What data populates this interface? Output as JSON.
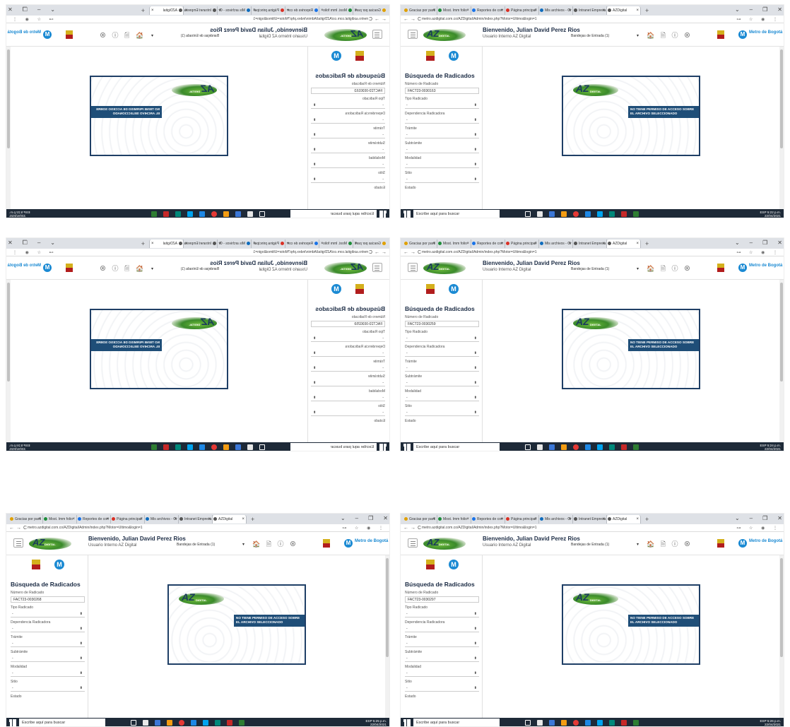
{
  "browser": {
    "tabs": [
      "Gracias por parti",
      "Most. Imm folio",
      "Reportes de corr",
      "Página principal",
      "Mis archivos - Or",
      "Intranet Empresa",
      "AZDigital"
    ],
    "new_tab": "+",
    "window_controls": [
      "⌄",
      "–",
      "❐",
      "✕"
    ]
  },
  "app": {
    "logo_main": "AZ",
    "logo_sub": "DIGITAL",
    "welcome": "Bienvenido, Julian David Perez Rios",
    "user_type": "Usuario Interno AZ Digital",
    "bandeja": "Bandejas de Entrada (1)",
    "header_icons": "🏠 🗎 ⓘ ⊗",
    "metro_logo_letter": "M",
    "metro_logo_text": "Metro de Bogotá",
    "panel_title": "Búsqueda de Radicados",
    "fields": {
      "numero_label": "Número de Radicado",
      "tipo_label": "Tipo Radicado",
      "dependencia_label": "Dependencia Radicadora",
      "tramite_label": "Trámite",
      "subtramite_label": "Subtrámite",
      "modalidad_label": "Modalidad",
      "sitio_label": "Sitio",
      "estado_label": "Estado",
      "select_default": "-"
    },
    "no_permission_message": "NO TIENE PERMISO DE ACCESO SOBRE EL ARCHIVO SELECCIONADO"
  },
  "taskbar": {
    "search_placeholder": "Escribe aquí para buscar",
    "lang": "ESP",
    "date": "22/04/2021"
  },
  "shots": [
    {
      "mirrored": true,
      "url": "metro.azdigital.com.co/AZDigital/Admin/index.php?Motor=Ultimo&login=1",
      "radicado": "FACT23-0030163",
      "time": "5:22 p.m."
    },
    {
      "mirrored": false,
      "url": "metro.azdigital.com.co/AZDigital/Admin/index.php?Motor=Ultimo&login=1",
      "radicado": "FACT23-0030163",
      "time": "5:22 p.m."
    },
    {
      "mirrored": true,
      "url": "metro.azdigital.com.co/AZDigital/Admin/index.php?Motor=Ultimo&login=1",
      "radicado": "FACT23-0030259",
      "time": "5:24 p.m."
    },
    {
      "mirrored": false,
      "url": "metro.azdigital.com.co/AZDigital/Admin/index.php?Motor=Ultimo&login=1",
      "radicado": "FACT23-0030259",
      "time": "5:24 p.m."
    },
    {
      "mirrored": false,
      "url": "metro.azdigital.com.co/AZDigital/Admin/index.php?Motor=Ultimo&login=1",
      "radicado": "FACT23-0030268",
      "time": "5:25 p.m."
    },
    {
      "mirrored": false,
      "url": "metro.azdigital.com.co/AZDigital/Admin/index.php?Motor=Ultimo&login=1",
      "radicado": "FACT23-0030297",
      "time": "5:26 p.m."
    }
  ]
}
